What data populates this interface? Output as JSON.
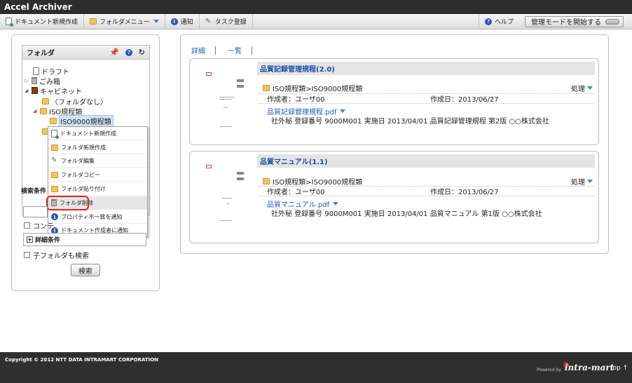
{
  "app": {
    "title": "Accel Archiver"
  },
  "toolbar": {
    "new_document": "ドキュメント新規作成",
    "folder_menu": "フォルダメニュー",
    "notify": "通知",
    "task_register": "タスク登録",
    "help": "ヘルプ",
    "admin_mode": "管理モードを開始する"
  },
  "folder_panel": {
    "title": "フォルダ",
    "tree": {
      "draft": "ドラフト",
      "trash": "ごみ箱",
      "cabinet": "キャビネット",
      "no_folder": "〈フォルダなし〉",
      "iso_rules": "ISO規程類",
      "iso9000": "ISO9000規程類"
    },
    "context_menu": {
      "new_document": "ドキュメント新規作成",
      "new_folder": "フォルダ新規作成",
      "edit_folder": "フォルダ編集",
      "copy_folder": "フォルダコピー",
      "paste_folder": "フォルダ貼り付け",
      "delete_folder": "フォルダ削除",
      "notify_property": "プロパティ不一致を通知",
      "notify_creator": "ドキュメント作成者に通知"
    }
  },
  "search": {
    "heading": "検索条件",
    "content_checkbox": "コンテ",
    "detail_conditions": "詳細条件",
    "include_subfolders": "子フォルダも検索",
    "search_button": "検索"
  },
  "view": {
    "detail": "詳細",
    "list": "一覧"
  },
  "documents": [
    {
      "title": "品質記録管理規程(2.0)",
      "path": "ISO規程類>ISO9000規程類",
      "action": "処理",
      "creator": "作成者：ユーザ00",
      "created": "作成日：2013/06/27",
      "file": "品質記録管理規程.pdf",
      "description": "社外秘  登録番号 9000M001  実施日 2013/04/01 品質記録管理規程 第2版 ○○株式会社"
    },
    {
      "title": "品質マニュアル(1.1)",
      "path": "ISO規程類>ISO9000規程類",
      "action": "処理",
      "creator": "作成者：ユーザ00",
      "created": "作成日：2013/06/27",
      "file": "品質マニュアル.pdf",
      "description": "社外秘  登録番号 9000M001  実施日 2013/04/01 品質マニュアル 第1版 ○○株式会社"
    }
  ],
  "footer": {
    "copyright": "Copyright © 2012 NTT DATA INTRAMART CORPORATION",
    "powered_by": "Powered by",
    "brand": "intra-mart",
    "top_link": "top ↑"
  }
}
